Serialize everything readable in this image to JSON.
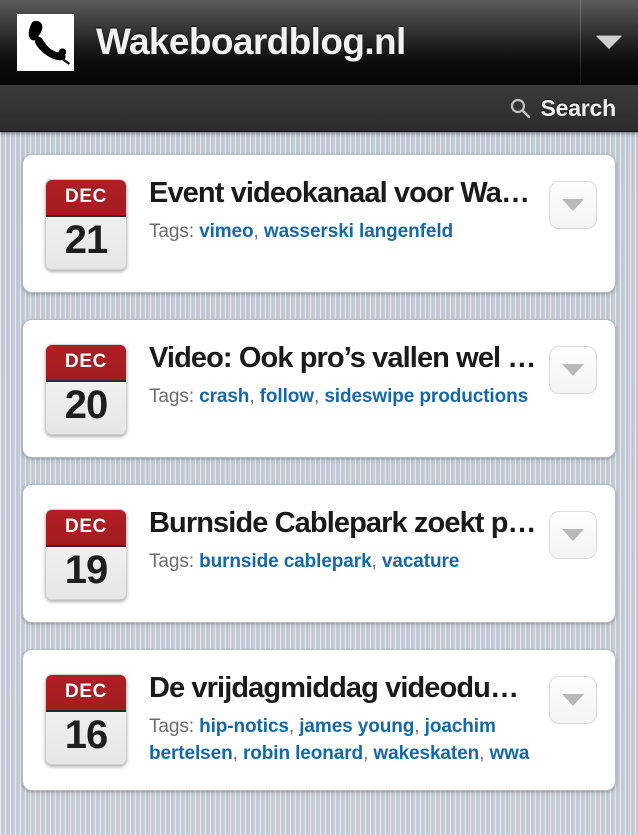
{
  "header": {
    "site_title": "Wakeboardblog.nl",
    "logo_icon": "wakeboarder-silhouette-logo",
    "menu_icon": "chevron-down-icon"
  },
  "search": {
    "icon": "search-icon",
    "label": "Search"
  },
  "posts": [
    {
      "month": "DEC",
      "day": "21",
      "title": "Event videokanaal voor Was…",
      "tags_label": "Tags:",
      "tags": [
        "vimeo",
        "wasserski langenfeld"
      ],
      "menu_icon": "chevron-down-icon"
    },
    {
      "month": "DEC",
      "day": "20",
      "title": "Video: Ook pro’s vallen wel …",
      "tags_label": "Tags:",
      "tags": [
        "crash",
        "follow",
        "sideswipe productions"
      ],
      "menu_icon": "chevron-down-icon"
    },
    {
      "month": "DEC",
      "day": "19",
      "title": "Burnside Cablepark zoekt p…",
      "tags_label": "Tags:",
      "tags": [
        "burnside cablepark",
        "vacature"
      ],
      "menu_icon": "chevron-down-icon"
    },
    {
      "month": "DEC",
      "day": "16",
      "title": "De vrijdagmiddag videodum…",
      "tags_label": "Tags:",
      "tags": [
        "hip-notics",
        "james young",
        "joachim bertelsen",
        "robin leonard",
        "wakeskaten",
        "wwa"
      ],
      "menu_icon": "chevron-down-icon"
    }
  ],
  "colors": {
    "badge_red": "#a41c20",
    "tag_blue": "#1569a8",
    "header_black": "#0a0a0a",
    "searchbar_gray": "#333333",
    "page_background": "#c4ccd7"
  }
}
